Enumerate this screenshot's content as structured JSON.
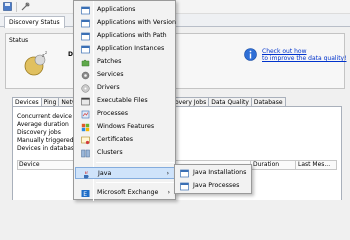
{
  "tab_title": "Discovery Status",
  "status": {
    "group_label": "Status",
    "partial_text": "Di",
    "link_line1": "Check out how",
    "link_line2": "to improve the data quality!"
  },
  "subtabs_left": [
    "Devices",
    "Ping",
    "Network"
  ],
  "subtabs_right": [
    "overy Jobs",
    "Data Quality",
    "Database"
  ],
  "stats": [
    "Concurrent device discov",
    "Average duration",
    "Discovery jobs",
    "Manually triggered",
    "Devices in database"
  ],
  "grid_headers": [
    "Device",
    "Duration",
    "Last Mes..."
  ],
  "menu": {
    "items": [
      {
        "label": "Applications",
        "icon": "window-icon"
      },
      {
        "label": "Applications with Version",
        "icon": "window-icon"
      },
      {
        "label": "Applications with Path",
        "icon": "window-icon"
      },
      {
        "label": "Application Instances",
        "icon": "window-icon"
      },
      {
        "label": "Patches",
        "icon": "puzzle-icon"
      },
      {
        "label": "Services",
        "icon": "gear-icon"
      },
      {
        "label": "Drivers",
        "icon": "disc-icon"
      },
      {
        "label": "Executable Files",
        "icon": "exe-icon"
      },
      {
        "label": "Processes",
        "icon": "process-icon"
      },
      {
        "label": "Windows Features",
        "icon": "features-icon"
      },
      {
        "label": "Certificates",
        "icon": "certificate-icon"
      },
      {
        "label": "Clusters",
        "icon": "clusters-icon"
      },
      {
        "label": "Java",
        "icon": "java-icon"
      },
      {
        "label": "Microsoft Exchange",
        "icon": "exchange-icon"
      }
    ],
    "highlighted": "Java",
    "arrow_glyph": "›"
  },
  "submenu": {
    "items": [
      {
        "label": "Java Installations",
        "icon": "window-icon"
      },
      {
        "label": "Java Processes",
        "icon": "window-icon"
      }
    ]
  },
  "colors": {
    "highlight_bg": "#cfe3fa",
    "highlight_border": "#84acdd",
    "link": "#0033cc"
  }
}
